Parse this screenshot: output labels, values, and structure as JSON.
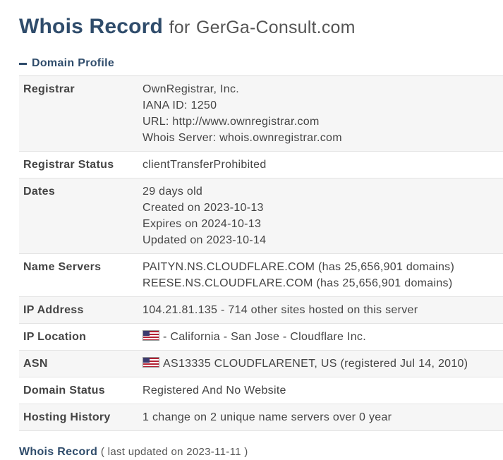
{
  "header": {
    "title": "Whois Record",
    "for_label": "for",
    "domain": "GerGa-Consult.com"
  },
  "section": {
    "toggle_label": "Domain Profile",
    "icon": "minus-icon"
  },
  "rows": [
    {
      "label": "Registrar",
      "lines": [
        "OwnRegistrar, Inc.",
        "IANA ID: 1250",
        "URL: http://www.ownregistrar.com",
        "Whois Server: whois.ownregistrar.com"
      ]
    },
    {
      "label": "Registrar Status",
      "lines": [
        "clientTransferProhibited"
      ]
    },
    {
      "label": "Dates",
      "lines": [
        "29 days old",
        "Created on 2023-10-13",
        "Expires on 2024-10-13",
        "Updated on 2023-10-14"
      ]
    },
    {
      "label": "Name Servers",
      "lines": [
        "PAITYN.NS.CLOUDFLARE.COM (has 25,656,901 domains)",
        "REESE.NS.CLOUDFLARE.COM (has 25,656,901 domains)"
      ]
    },
    {
      "label": "IP Address",
      "lines": [
        "104.21.81.135 - 714 other sites hosted on this server"
      ]
    },
    {
      "label": "IP Location",
      "flag": "us-flag-icon",
      "lines": [
        "- California - San Jose - Cloudflare Inc."
      ]
    },
    {
      "label": "ASN",
      "flag": "us-flag-icon",
      "lines": [
        "AS13335 CLOUDFLARENET, US (registered Jul 14, 2010)"
      ]
    },
    {
      "label": "Domain Status",
      "lines": [
        "Registered And No Website"
      ]
    },
    {
      "label": "Hosting History",
      "lines": [
        "1 change on 2 unique name servers over 0 year"
      ]
    }
  ],
  "footer": {
    "title": "Whois Record",
    "updated": "( last updated on 2023-11-11 )"
  },
  "colors": {
    "heading": "#2f4c6b",
    "text": "#444444",
    "row_alt": "#f6f6f6",
    "border": "#e4e4e4"
  }
}
